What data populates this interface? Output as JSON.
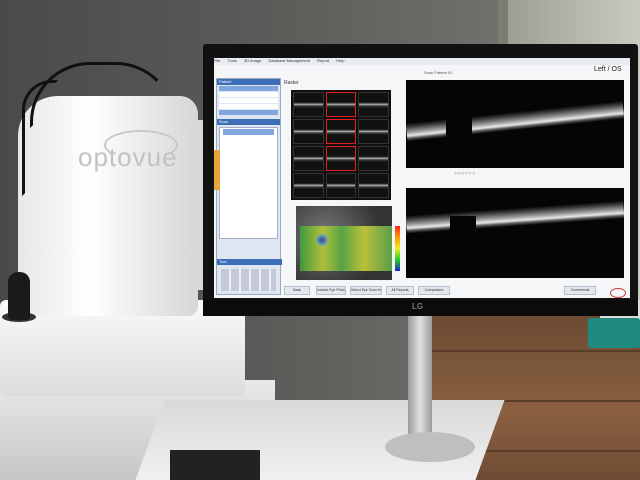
{
  "device": {
    "logo_text": "optovue"
  },
  "monitor": {
    "brand": "LG"
  },
  "screen": {
    "menu": [
      "File",
      "Tools",
      "3D Image",
      "Database Management",
      "Report",
      "Help"
    ],
    "scan_pattern_label": "Scan Pattern ID",
    "eye_label": "Left / OS",
    "raster_title": "Raster",
    "left_panel": {
      "patient_header": "Patient",
      "scan_header": "Scan",
      "tool_header": "Tool"
    },
    "buttons": [
      "Mask",
      "Include Eye Photo",
      "Select Eye Scan Image Merge",
      "All Reports",
      "Comparison",
      "Commercial"
    ]
  },
  "colors": {
    "accent_blue": "#3c6fb8",
    "selection_red": "#e02020",
    "panel_bg": "#dde6f2",
    "orange_tab": "#e7a63c"
  }
}
